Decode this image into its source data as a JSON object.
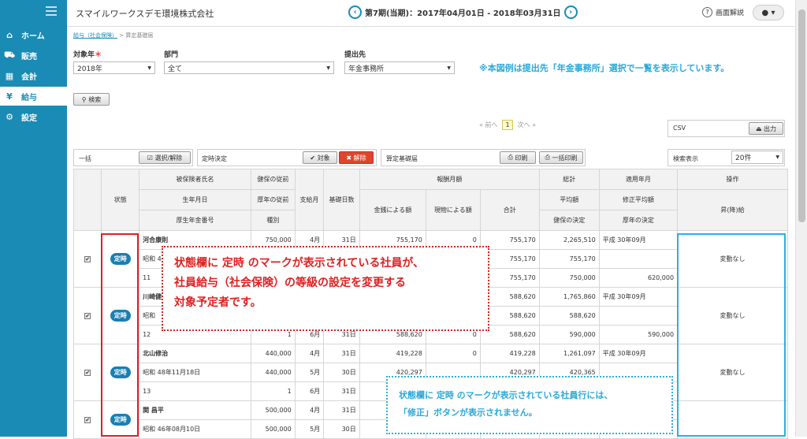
{
  "sidebar": {
    "items": [
      {
        "label": "ホーム",
        "icon": "home-icon",
        "glyph": "⌂"
      },
      {
        "label": "販売",
        "icon": "cart-icon",
        "glyph": "⛟"
      },
      {
        "label": "会計",
        "icon": "calculator-icon",
        "glyph": "▦"
      },
      {
        "label": "給与",
        "icon": "payroll-icon",
        "glyph": "¥"
      },
      {
        "label": "設定",
        "icon": "gear-icon",
        "glyph": "⚙"
      }
    ],
    "active": "給与"
  },
  "header": {
    "company": "スマイルワークスデモ環境株式会社",
    "period": "第7期(当期)：2017年04月01日 - 2018年03月31日",
    "help": "画面解説"
  },
  "breadcrumb": {
    "parent": "給与（社会保険）",
    "sep": ">",
    "current": "算定基礎届"
  },
  "filters": {
    "year_label": "対象年",
    "year_value": "2018年",
    "dept_label": "部門",
    "dept_value": "全て",
    "dest_label": "提出先",
    "dest_value": "年金事務所",
    "required_mark": "＊"
  },
  "note_top": "※本図例は提出先「年金事務所」選択で一覧を表示しています。",
  "search_button": "検索",
  "pager": {
    "prev": "« 前へ",
    "current": "1",
    "next": "次へ »"
  },
  "csv": {
    "label": "CSV",
    "button": "出力"
  },
  "bulk": {
    "label": "一括",
    "select_toggle": "選択/解除",
    "decision_label": "定時決定",
    "target": "対象",
    "cancel": "解除",
    "report_label": "算定基礎届",
    "print": "印刷",
    "print_all": "一括印刷",
    "display_label": "検索表示",
    "display_value": "20件"
  },
  "table": {
    "h_status": "状態",
    "h_name": "被保険者氏名",
    "h_birth": "生年月日",
    "h_welfare": "厚生年金番号",
    "h_kenpo_prev": "健保の従前",
    "h_kosei_prev": "厚年の従前",
    "h_kind": "種別",
    "h_month": "支給月",
    "h_days": "基礎日数",
    "h_pay": "報酬月額",
    "h_cash": "金銭による額",
    "h_kind_pay": "現物による額",
    "h_sum": "合計",
    "h_total": "総計",
    "h_avg": "平均額",
    "h_kenpo_det": "健保の決定",
    "h_apply": "適用年月",
    "h_mod_avg": "修正平均額",
    "h_kosei_det": "厚年の決定",
    "h_op": "操作",
    "h_grade": "昇(降)給",
    "employees": [
      {
        "status": "定時",
        "rows": [
          {
            "a": "河合康則",
            "b": "750,000",
            "m": "4月",
            "d": "31日",
            "cash": "755,170",
            "kind": "0",
            "sum": "755,170",
            "t": "2,265,510",
            "ap": "平成 30年09月"
          },
          {
            "a": "昭和 4",
            "b": "",
            "m": "",
            "d": "",
            "cash": "",
            "kind": "",
            "sum": "755,170",
            "t": "755,170",
            "ap": ""
          },
          {
            "a": "11",
            "b": "",
            "m": "",
            "d": "",
            "cash": "",
            "kind": "",
            "sum": "755,170",
            "t": "750,000",
            "ap": "620,000"
          }
        ],
        "grade": "変動なし"
      },
      {
        "status": "定時",
        "rows": [
          {
            "a": "川崎健",
            "b": "",
            "m": "",
            "d": "",
            "cash": "",
            "kind": "",
            "sum": "588,620",
            "t": "1,765,860",
            "ap": "平成 30年09月"
          },
          {
            "a": "昭和",
            "b": "",
            "m": "",
            "d": "",
            "cash": "",
            "kind": "",
            "sum": "588,620",
            "t": "588,620",
            "ap": ""
          },
          {
            "a": "12",
            "b": "1",
            "m": "6月",
            "d": "31日",
            "cash": "588,620",
            "kind": "0",
            "sum": "588,620",
            "t": "590,000",
            "ap": "590,000"
          }
        ],
        "grade": "変動なし"
      },
      {
        "status": "定時",
        "rows": [
          {
            "a": "北山修治",
            "b": "440,000",
            "m": "4月",
            "d": "31日",
            "cash": "419,228",
            "kind": "0",
            "sum": "419,228",
            "t": "1,261,097",
            "ap": "平成 30年09月"
          },
          {
            "a": "昭和 48年11月18日",
            "b": "440,000",
            "m": "5月",
            "d": "30日",
            "cash": "420,297",
            "kind": "",
            "sum": "420,297",
            "t": "420,365",
            "ap": ""
          },
          {
            "a": "13",
            "b": "1",
            "m": "6月",
            "d": "31日",
            "cash": "",
            "kind": "",
            "sum": "",
            "t": "",
            "ap": ""
          }
        ],
        "grade": "変動なし"
      },
      {
        "status": "定時",
        "rows": [
          {
            "a": "関 昌平",
            "b": "500,000",
            "m": "4月",
            "d": "31日",
            "cash": "",
            "kind": "",
            "sum": "",
            "t": "",
            "ap": ""
          },
          {
            "a": "昭和 46年08月10日",
            "b": "500,000",
            "m": "5月",
            "d": "30日",
            "cash": "",
            "kind": "",
            "sum": "",
            "t": "",
            "ap": ""
          }
        ],
        "grade": ""
      }
    ]
  },
  "callout_red": [
    "状態欄に 定時 のマークが表示されている社員が、",
    "社員給与（社会保険）の等級の設定を変更する",
    "対象予定者です。"
  ],
  "callout_blue": [
    "状態欄に 定時 のマークが表示されている社員行には、",
    "「修正」ボタンが表示されません。"
  ],
  "colors": {
    "sidebar": "#1a8bb4",
    "badge": "#1a7fb2",
    "red": "#e02020",
    "blue": "#2ab0e0"
  }
}
